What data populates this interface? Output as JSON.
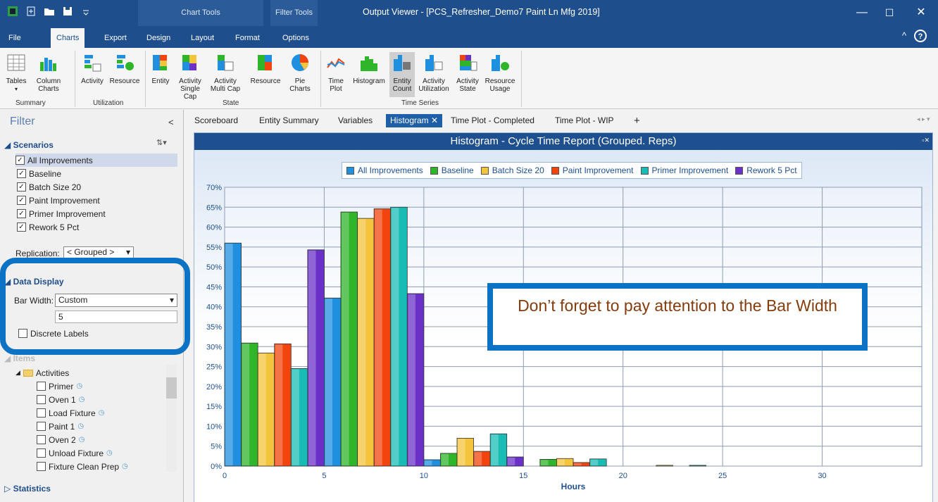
{
  "window": {
    "title": "Output Viewer - [PCS_Refresher_Demo7 Paint Ln Mfg 2019]",
    "context_chart_tools": "Chart Tools",
    "context_filter_tools": "Filter Tools",
    "minimize": "—",
    "maximize": "☐",
    "close": "✕",
    "help": "?",
    "collapse_ribbon": "^"
  },
  "ribbon_tabs": [
    "File",
    "Charts",
    "Export",
    "Design",
    "Layout",
    "Format",
    "Options"
  ],
  "ribbon": {
    "summary": {
      "label": "Summary",
      "buttons": [
        "Tables",
        "Column Charts"
      ]
    },
    "utilization": {
      "label": "Utilization",
      "buttons": [
        "Activity",
        "Resource"
      ]
    },
    "state": {
      "label": "State",
      "buttons": [
        "Entity",
        "Activity Single Cap",
        "Activity Multi Cap",
        "Resource",
        "Pie Charts"
      ]
    },
    "time_series": {
      "label": "Time Series",
      "buttons": [
        "Time Plot",
        "Histogram",
        "Entity Count",
        "Activity Utilization",
        "Activity State",
        "Resource Usage"
      ]
    }
  },
  "filter": {
    "title": "Filter",
    "collapse_glyph": "<",
    "scenarios_header": "Scenarios",
    "scenarios": [
      {
        "label": "All Improvements",
        "checked": true
      },
      {
        "label": "Baseline",
        "checked": true
      },
      {
        "label": "Batch Size 20",
        "checked": true
      },
      {
        "label": "Paint Improvement",
        "checked": true
      },
      {
        "label": "Primer Improvement",
        "checked": true
      },
      {
        "label": "Rework 5 Pct",
        "checked": true
      }
    ],
    "replication_label": "Replication:",
    "replication_value": "< Grouped >",
    "data_display_header": "Data Display",
    "bar_width_label": "Bar Width:",
    "bar_width_value": "Custom",
    "bar_width_number": "5",
    "discrete_labels": "Discrete Labels",
    "items_header": "Items",
    "activities_label": "Activities",
    "activities": [
      "Primer",
      "Oven 1",
      "Load Fixture",
      "Paint 1",
      "Oven 2",
      "Unload Fixture",
      "Fixture Clean  Prep"
    ],
    "statistics_header": "Statistics"
  },
  "doc_tabs": [
    "Scoreboard",
    "Entity Summary",
    "Variables",
    "Histogram",
    "Time Plot - Completed",
    "Time Plot - WIP",
    "+"
  ],
  "callout_text": "Don’t forget to pay attention to the Bar Width",
  "chart_data": {
    "type": "bar",
    "title": "Histogram - Cycle Time Report (Grouped. Reps)",
    "xlabel": "Hours",
    "ylabel": "",
    "xlim": [
      0,
      35
    ],
    "ylim": [
      0,
      70
    ],
    "x_ticks": [
      0,
      5,
      10,
      15,
      20,
      25,
      30
    ],
    "y_ticks": [
      "0%",
      "5%",
      "10%",
      "15%",
      "20%",
      "25%",
      "30%",
      "35%",
      "40%",
      "45%",
      "50%",
      "55%",
      "60%",
      "65%",
      "70%"
    ],
    "bins": [
      0,
      5,
      10,
      15,
      20
    ],
    "legend_position": "top",
    "series": [
      {
        "name": "All Improvements",
        "color": "#1f8fe0",
        "values": [
          56,
          42.2,
          1.6,
          0,
          0
        ]
      },
      {
        "name": "Baseline",
        "color": "#2fb52a",
        "values": [
          30.9,
          63.8,
          3.2,
          1.7,
          0
        ]
      },
      {
        "name": "Batch Size 20",
        "color": "#f5c43d",
        "values": [
          28.4,
          62.2,
          7.0,
          1.9,
          0.2
        ]
      },
      {
        "name": "Paint Improvement",
        "color": "#f2440c",
        "values": [
          30.7,
          64.6,
          3.7,
          0.9,
          0
        ]
      },
      {
        "name": "Primer Improvement",
        "color": "#19bcb5",
        "values": [
          24.5,
          65.0,
          8.1,
          1.8,
          0.2
        ]
      },
      {
        "name": "Rework 5 Pct",
        "color": "#6a30c8",
        "values": [
          54.3,
          43.3,
          2.3,
          0,
          0
        ]
      }
    ]
  }
}
